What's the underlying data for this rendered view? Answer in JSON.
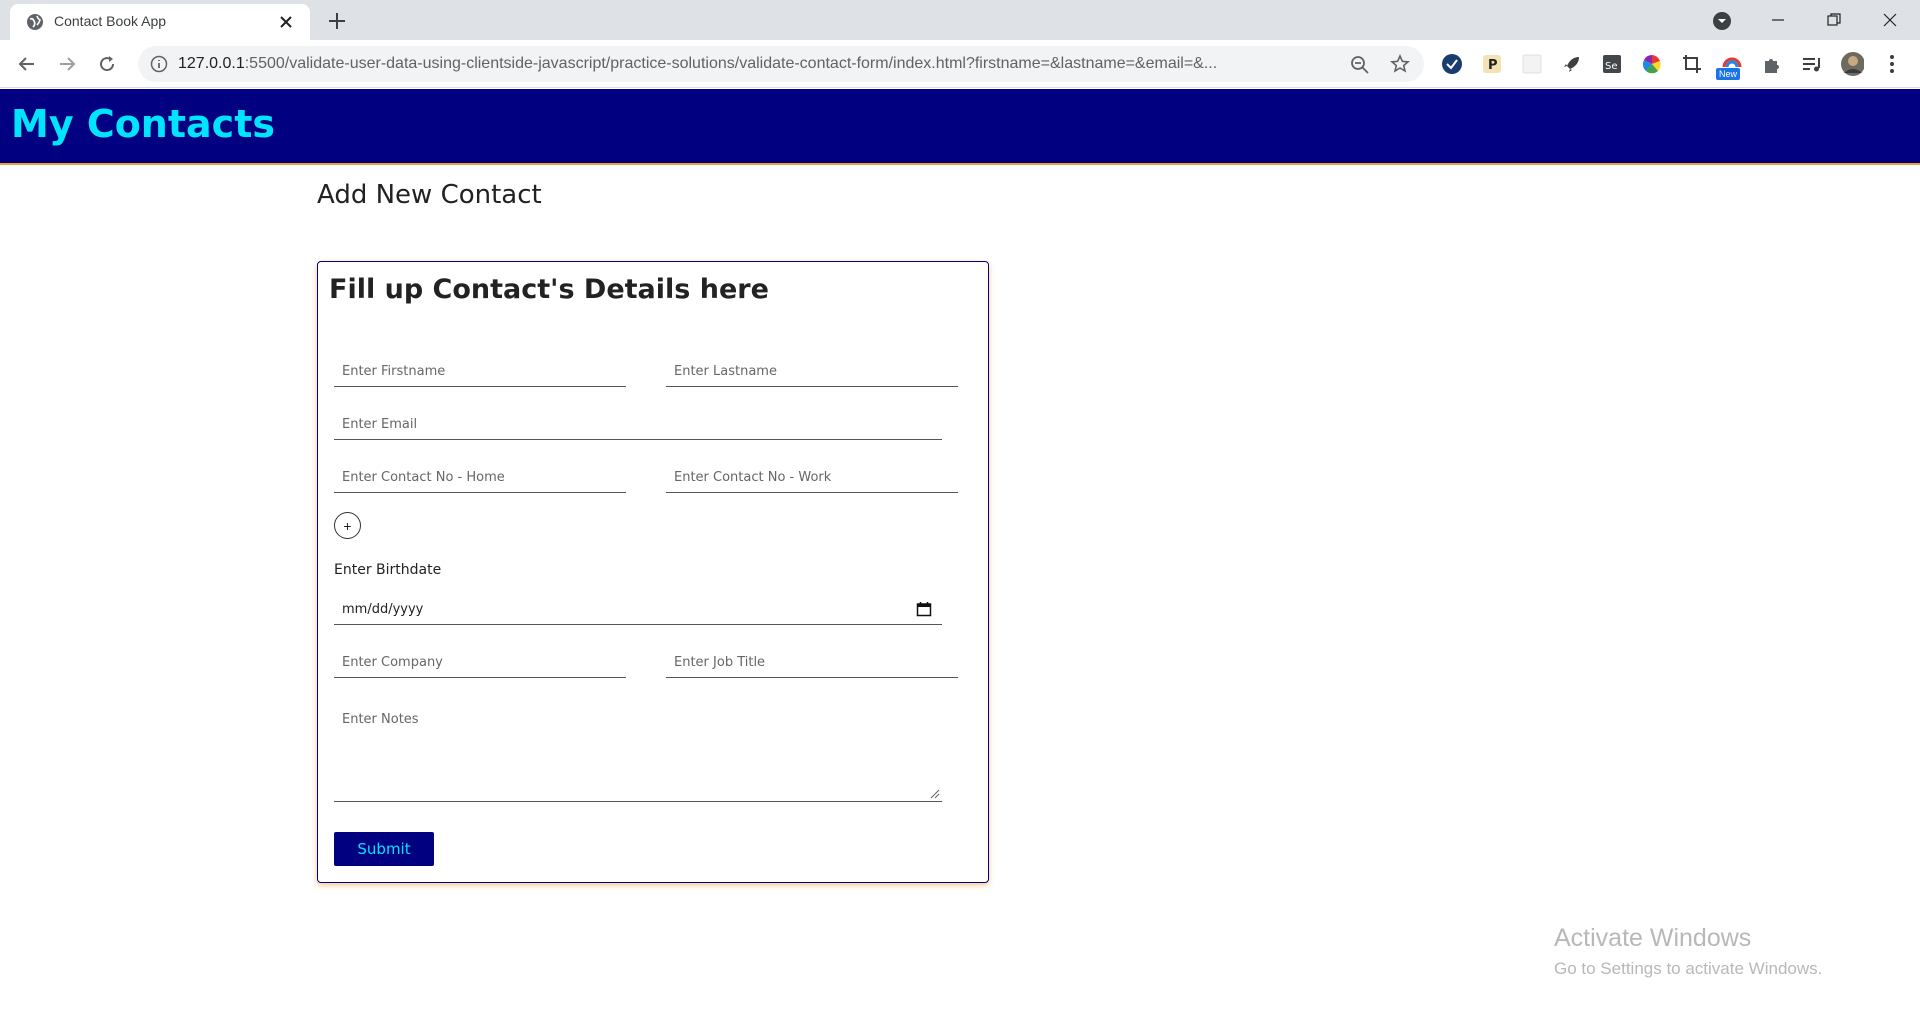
{
  "browser": {
    "tab_title": "Contact Book App",
    "url_host": "127.0.0.1",
    "url_path": ":5500/validate-user-data-using-clientside-javascript/practice-solutions/validate-contact-form/index.html?firstname=&lastname=&email=&...",
    "extension_badge": "New"
  },
  "header": {
    "title": "My Contacts"
  },
  "page": {
    "heading": "Add New Contact"
  },
  "form": {
    "title": "Fill up Contact's Details here",
    "firstname_placeholder": "Enter Firstname",
    "lastname_placeholder": "Enter Lastname",
    "email_placeholder": "Enter Email",
    "phone_home_placeholder": "Enter Contact No - Home",
    "phone_work_placeholder": "Enter Contact No - Work",
    "add_phone_label": "+",
    "birthdate_label": "Enter Birthdate",
    "birthdate_value": "mm/dd/yyyy",
    "company_placeholder": "Enter Company",
    "job_title_placeholder": "Enter Job Title",
    "notes_placeholder": "Enter Notes",
    "submit_label": "Submit"
  },
  "watermark": {
    "title": "Activate Windows",
    "subtitle": "Go to Settings to activate Windows."
  },
  "colors": {
    "header_bg": "#000080",
    "header_text": "#00e5ff",
    "accent_border": "#f0a030"
  }
}
